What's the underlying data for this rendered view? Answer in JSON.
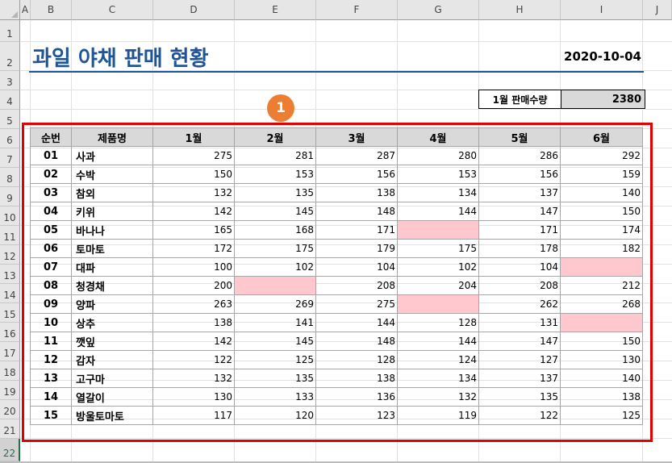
{
  "columns": [
    "A",
    "B",
    "C",
    "D",
    "E",
    "F",
    "G",
    "H",
    "I",
    "J"
  ],
  "rows": [
    "1",
    "2",
    "3",
    "4",
    "5",
    "6",
    "7",
    "8",
    "9",
    "10",
    "11",
    "12",
    "13",
    "14",
    "15",
    "16",
    "17",
    "18",
    "19",
    "20",
    "21",
    "22"
  ],
  "active_row": "22",
  "title": "과일 야채 판매 현황",
  "date": "2020-10-04",
  "summary": {
    "label": "1월 판매수량",
    "value": "2380"
  },
  "badge": "1",
  "colors": {
    "title": "#1f5597",
    "badge": "#ed7d31",
    "empty_cell": "#ffc7ce",
    "frame": "#e00000",
    "header_fill": "#d9d9d9"
  },
  "table": {
    "headers": [
      "순번",
      "제품명",
      "1월",
      "2월",
      "3월",
      "4월",
      "5월",
      "6월"
    ],
    "rows": [
      {
        "no": "01",
        "name": "사과",
        "v": [
          "275",
          "281",
          "287",
          "280",
          "286",
          "292"
        ]
      },
      {
        "no": "02",
        "name": "수박",
        "v": [
          "150",
          "153",
          "156",
          "153",
          "156",
          "159"
        ]
      },
      {
        "no": "03",
        "name": "참외",
        "v": [
          "132",
          "135",
          "138",
          "134",
          "137",
          "140"
        ]
      },
      {
        "no": "04",
        "name": "키위",
        "v": [
          "142",
          "145",
          "148",
          "144",
          "147",
          "150"
        ]
      },
      {
        "no": "05",
        "name": "바나나",
        "v": [
          "165",
          "168",
          "171",
          "",
          "171",
          "174"
        ]
      },
      {
        "no": "06",
        "name": "토마토",
        "v": [
          "172",
          "175",
          "179",
          "175",
          "178",
          "182"
        ]
      },
      {
        "no": "07",
        "name": "대파",
        "v": [
          "100",
          "102",
          "104",
          "102",
          "104",
          ""
        ]
      },
      {
        "no": "08",
        "name": "청경채",
        "v": [
          "200",
          "",
          "208",
          "204",
          "208",
          "212"
        ]
      },
      {
        "no": "09",
        "name": "양파",
        "v": [
          "263",
          "269",
          "275",
          "",
          "262",
          "268"
        ]
      },
      {
        "no": "10",
        "name": "상추",
        "v": [
          "138",
          "141",
          "144",
          "128",
          "131",
          ""
        ]
      },
      {
        "no": "11",
        "name": "깻잎",
        "v": [
          "142",
          "145",
          "148",
          "144",
          "147",
          "150"
        ]
      },
      {
        "no": "12",
        "name": "감자",
        "v": [
          "122",
          "125",
          "128",
          "124",
          "127",
          "130"
        ]
      },
      {
        "no": "13",
        "name": "고구마",
        "v": [
          "132",
          "135",
          "138",
          "134",
          "137",
          "140"
        ]
      },
      {
        "no": "14",
        "name": "열갈이",
        "v": [
          "130",
          "133",
          "136",
          "132",
          "135",
          "138"
        ]
      },
      {
        "no": "15",
        "name": "방울토마토",
        "v": [
          "117",
          "120",
          "123",
          "119",
          "122",
          "125"
        ]
      }
    ]
  }
}
